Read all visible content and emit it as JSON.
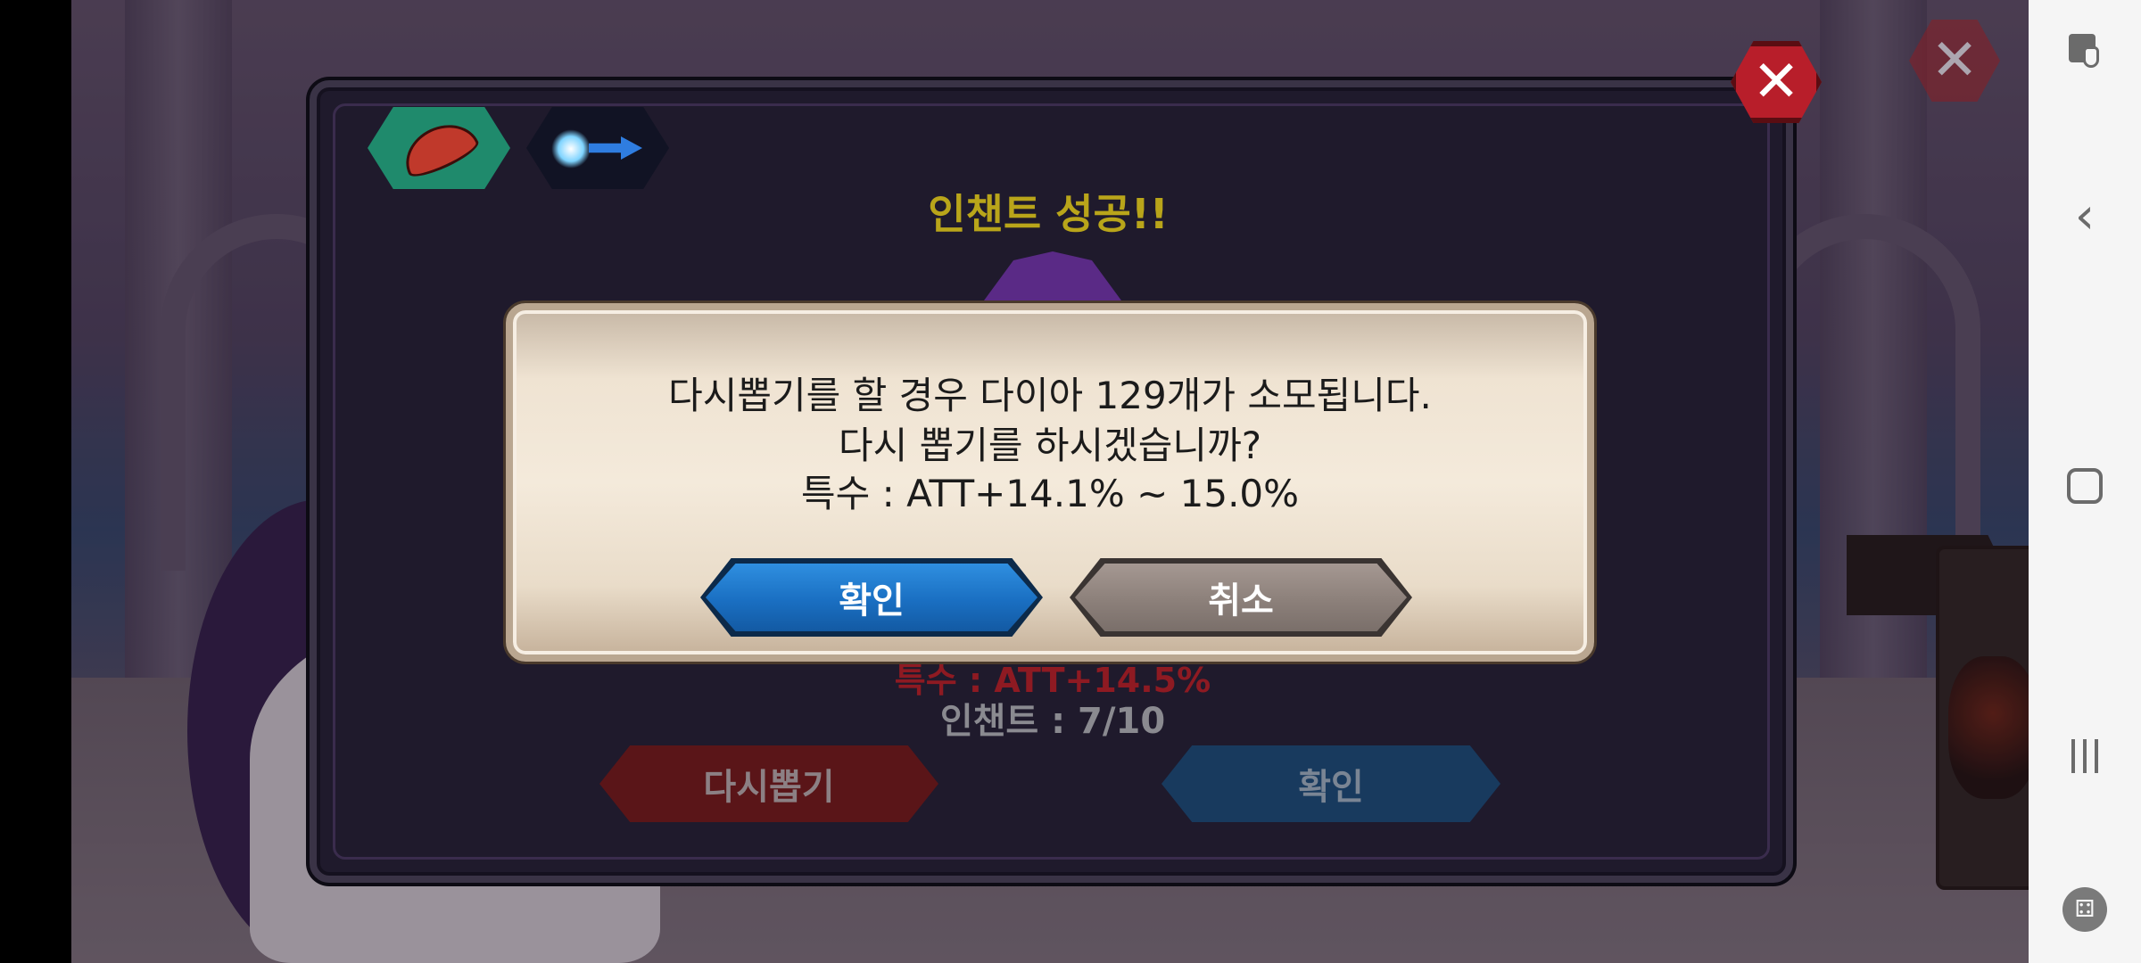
{
  "game": {
    "panel": {
      "title": "인챈트 성공!!",
      "stat_text": "특수 : ATT+14.5%",
      "enchant_text": "인챈트 : 7/10",
      "reroll_label": "다시뽑기",
      "confirm_label": "확인"
    },
    "dialog": {
      "line1": "다시뽑기를 할 경우 다이아 129개가 소모됩니다.",
      "line2": "다시 뽑기를 하시겠습니까?",
      "line3": "특수 : ATT+14.1% ~ 15.0%",
      "ok_label": "확인",
      "cancel_label": "취소"
    },
    "tabs": [
      {
        "icon": "feather-icon",
        "active": true
      },
      {
        "icon": "enchant-effect-icon",
        "active": false
      }
    ],
    "colors": {
      "title": "#b9a51a",
      "stat": "#8e1a22",
      "ok_button": "#1a6fc2",
      "cancel_button": "#8c807a",
      "reroll_button": "#5a1518",
      "close_button": "#b81e2a"
    }
  },
  "navbar": {
    "icons": [
      "touch-lock-icon",
      "back-icon",
      "home-icon",
      "recent-apps-icon",
      "game-launcher-icon"
    ]
  }
}
